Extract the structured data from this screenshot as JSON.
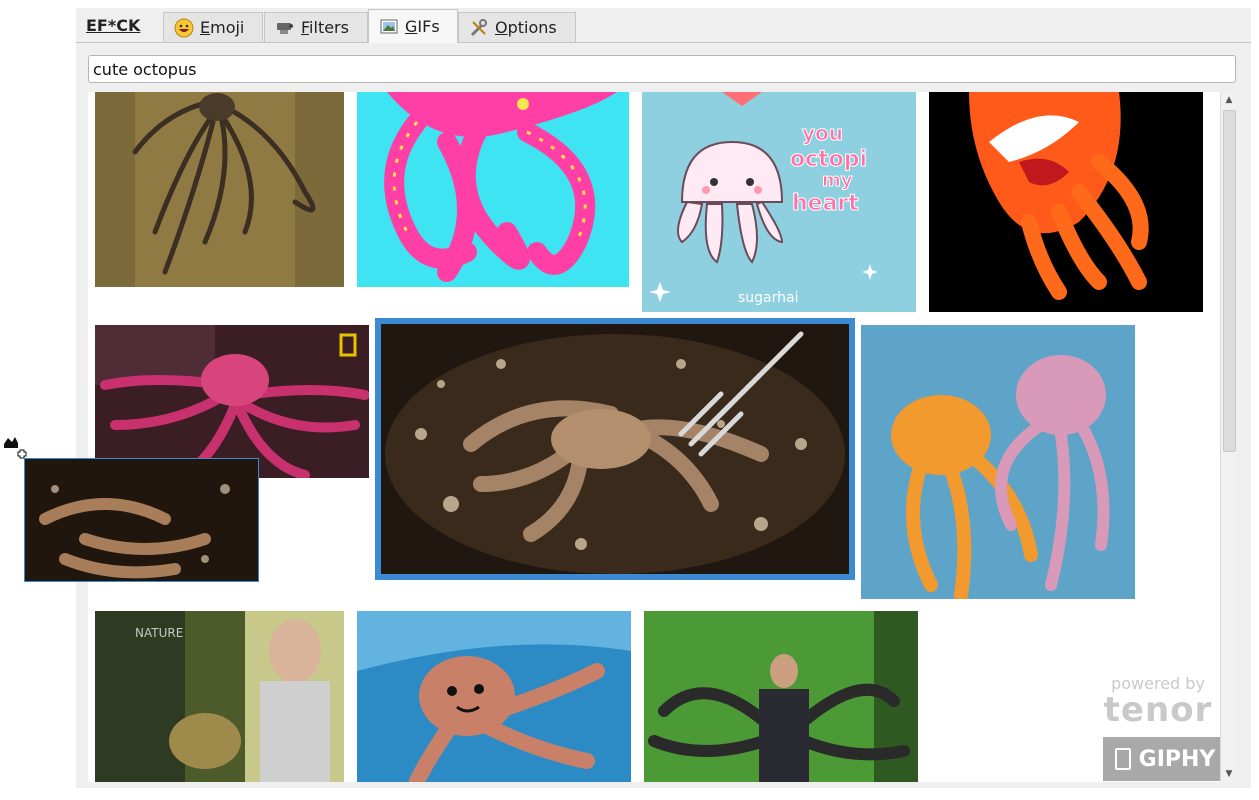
{
  "app": {
    "brand": "EF*CK"
  },
  "tabs": [
    {
      "label": "Emoji",
      "icon": "grinning-face-icon",
      "active": false
    },
    {
      "label": "Filters",
      "icon": "filter-icon",
      "active": false
    },
    {
      "label": "GIFs",
      "icon": "picture-icon",
      "active": true
    },
    {
      "label": "Options",
      "icon": "tools-icon",
      "active": false
    }
  ],
  "search": {
    "value": "cute octopus"
  },
  "results": {
    "items": [
      {
        "name": "octopus-on-wall-gif"
      },
      {
        "name": "pink-pixel-octopus-gif"
      },
      {
        "name": "you-octopi-my-heart-gif",
        "text_lines": [
          "you",
          "octopi",
          "my",
          "heart"
        ],
        "credit": "sugarhai"
      },
      {
        "name": "orange-cartoon-octopus-gif"
      },
      {
        "name": "red-octopus-coral-gif",
        "badge": "nat-geo-icon"
      },
      {
        "name": "octopus-in-pan-gif",
        "selected": true
      },
      {
        "name": "two-octopuses-dancing-gif"
      },
      {
        "name": "nature-octopus-man-gif",
        "watermark": "NATURE"
      },
      {
        "name": "smiling-octopus-gif"
      },
      {
        "name": "doctor-octopus-gif"
      }
    ]
  },
  "footer": {
    "powered_by": "powered by",
    "tenor": "tenor",
    "giphy": "GIPHY"
  },
  "colors": {
    "selection": "#3c8ad2",
    "tab_bg": "#e5e5e5",
    "window_bg": "#efefef"
  }
}
